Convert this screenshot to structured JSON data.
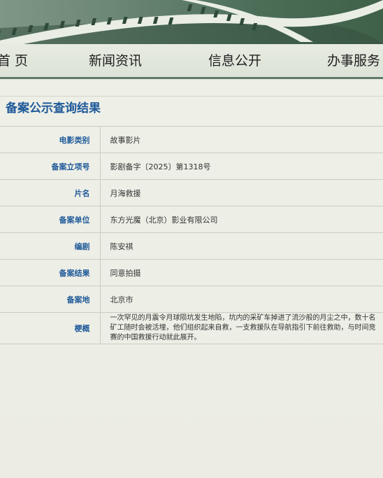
{
  "nav": {
    "items": [
      {
        "label": "首 页"
      },
      {
        "label": "新闻资讯"
      },
      {
        "label": "信息公开"
      },
      {
        "label": "办事服务"
      }
    ]
  },
  "page": {
    "title": "备案公示查询结果"
  },
  "record": [
    {
      "label": "电影类别",
      "value": "故事影片"
    },
    {
      "label": "备案立项号",
      "value": "影剧备字〔2025〕第1318号"
    },
    {
      "label": "片名",
      "value": "月海救援"
    },
    {
      "label": "备案单位",
      "value": "东方光魔（北京）影业有限公司"
    },
    {
      "label": "编剧",
      "value": "陈安祺"
    },
    {
      "label": "备案结果",
      "value": "同意拍摄"
    },
    {
      "label": "备案地",
      "value": "北京市"
    },
    {
      "label": "梗概",
      "value": "一次罕见的月震令月球陨坑发生地陷，坑内的采矿车掉进了流沙般的月尘之中，数十名矿工随时会被活埋，他们组织起来自救，一支救援队在导航指引下前往救助，与时间竞赛的中国救援行动就此展开。"
    }
  ],
  "colors": {
    "accent": "#1f5a99",
    "banner": "#4d6f59",
    "background": "#eef0e8"
  }
}
